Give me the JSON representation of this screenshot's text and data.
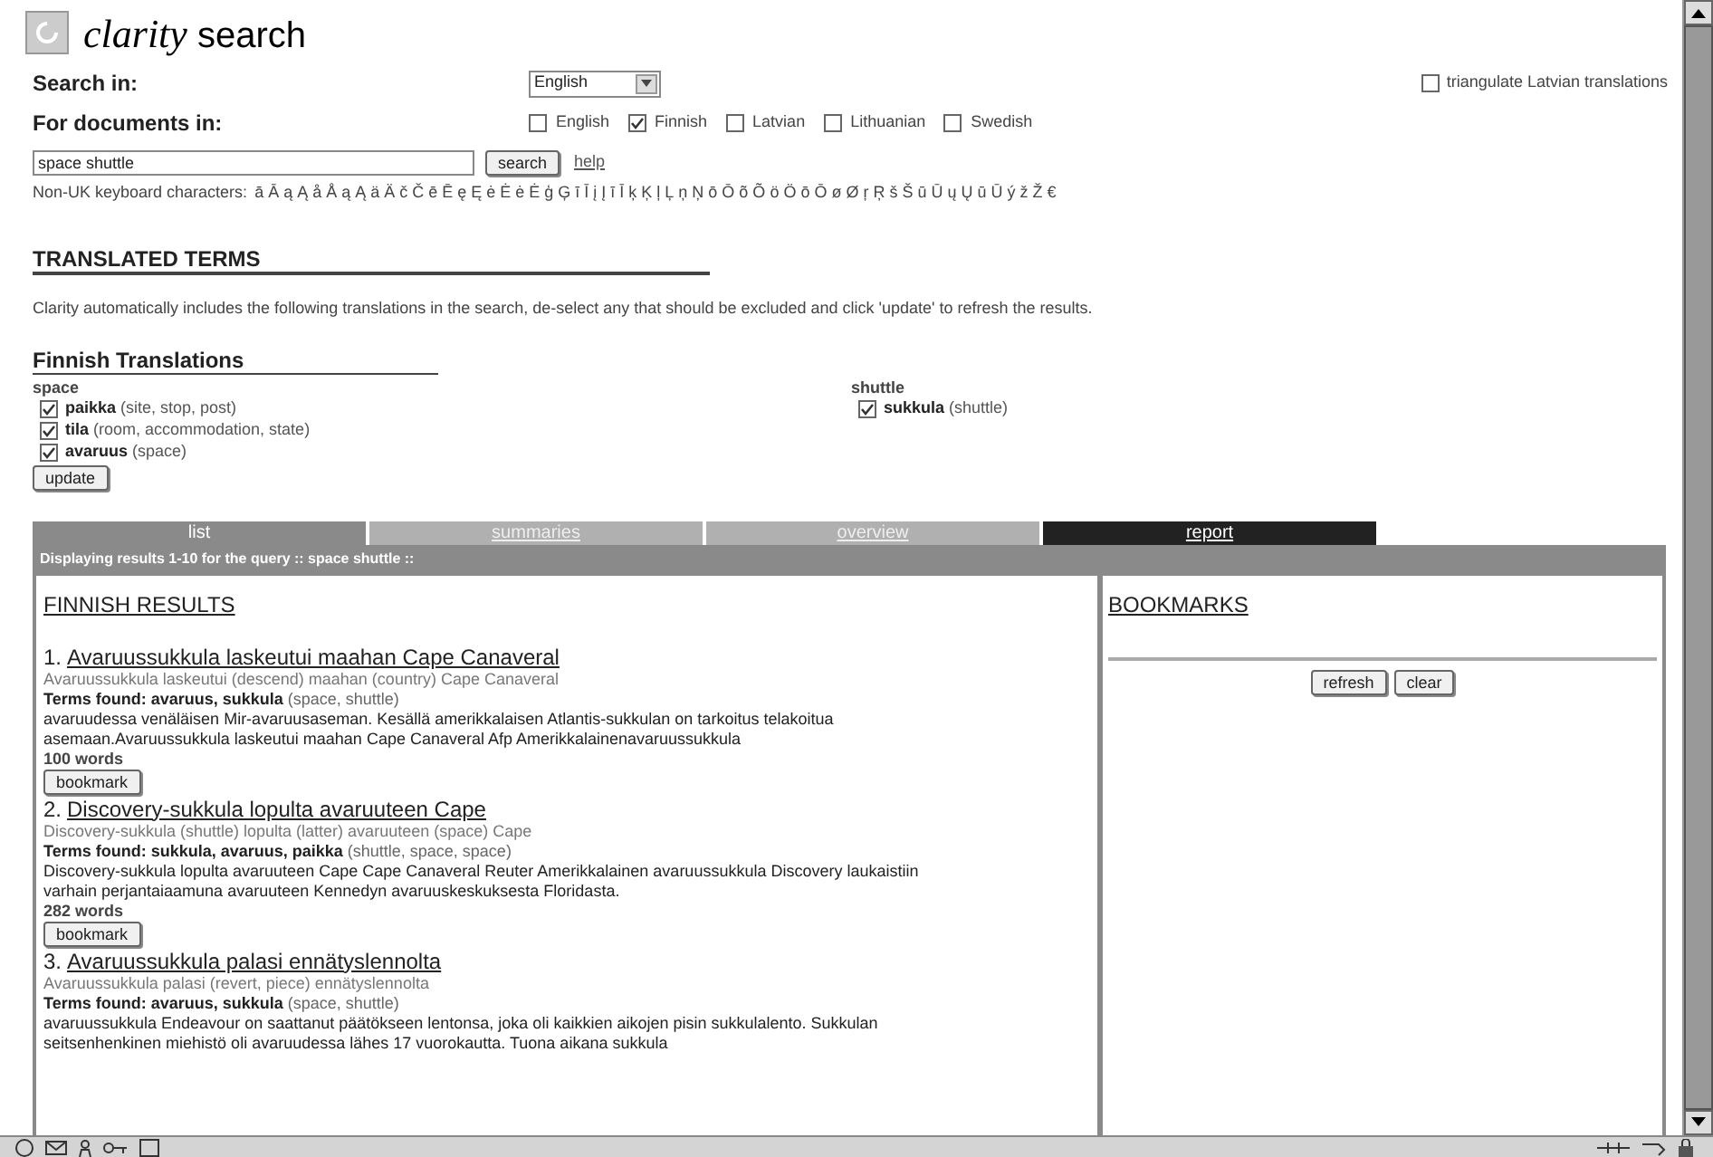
{
  "logo": {
    "italic": "clarity",
    "rest": "search"
  },
  "search_in": {
    "label": "Search in:",
    "value": "English"
  },
  "triangulate": {
    "label": "triangulate Latvian translations",
    "checked": false
  },
  "documents_in": {
    "label": "For documents in:",
    "languages": [
      {
        "label": "English",
        "checked": false
      },
      {
        "label": "Finnish",
        "checked": true
      },
      {
        "label": "Latvian",
        "checked": false
      },
      {
        "label": "Lithuanian",
        "checked": false
      },
      {
        "label": "Swedish",
        "checked": false
      }
    ]
  },
  "query": {
    "value": "space shuttle",
    "button": "search",
    "help": "help"
  },
  "keyboard": {
    "label": "Non-UK keyboard characters:",
    "chars": "ā Ā ą Ą å Å ą Ą ä Ä č Č ē Ē ę Ę ė Ė ė Ė ģ Ģ ī Ī į Į ī Ī ķ Ķ ļ Ļ ņ Ņ ō Ō õ Õ ö Ö ō Ō ø Ø ŗ Ŗ š Š ū Ū ų Ų ū Ū ý ž Ž €"
  },
  "translated_terms": {
    "heading": "TRANSLATED TERMS",
    "note": "Clarity automatically includes the following translations in the search, de-select any that should be excluded and click 'update' to refresh the results."
  },
  "translations": {
    "heading": "Finnish Translations",
    "groups": [
      {
        "term": "space",
        "items": [
          {
            "word": "paikka",
            "gloss": "(site, stop, post)",
            "checked": true
          },
          {
            "word": "tila",
            "gloss": "(room, accommodation, state)",
            "checked": true
          },
          {
            "word": "avaruus",
            "gloss": "(space)",
            "checked": true
          }
        ]
      },
      {
        "term": "shuttle",
        "items": [
          {
            "word": "sukkula",
            "gloss": "(shuttle)",
            "checked": true
          }
        ]
      }
    ],
    "button": "update"
  },
  "tabs": [
    {
      "label": "list",
      "selected": true,
      "kind": "normal"
    },
    {
      "label": "summaries",
      "selected": false,
      "kind": "normal"
    },
    {
      "label": "overview",
      "selected": false,
      "kind": "normal"
    },
    {
      "label": "report",
      "selected": false,
      "kind": "dark"
    }
  ],
  "results_bar": "Displaying results 1-10 for the query :: space shuttle ::",
  "results": {
    "heading": "FINNISH RESULTS",
    "items": [
      {
        "number": "1.",
        "title": "Avaruussukkula laskeutui maahan Cape Canaveral",
        "gloss": "Avaruussukkula laskeutui (descend) maahan (country) Cape Canaveral",
        "terms_label": "Terms found:",
        "terms": "avaruus, sukkula",
        "terms_gloss": "(space, shuttle)",
        "snippet": "avaruudessa venäläisen Mir-avaruusaseman. Kesällä amerikkalaisen Atlantis-sukkulan on tarkoitus telakoitua asemaan.Avaruussukkula laskeutui maahan Cape Canaveral Afp Amerikkalainenavaruussukkula",
        "words": "100 words",
        "button": "bookmark"
      },
      {
        "number": "2.",
        "title": "Discovery-sukkula lopulta avaruuteen Cape",
        "gloss": "Discovery-sukkula (shuttle) lopulta (latter) avaruuteen (space) Cape",
        "terms_label": "Terms found:",
        "terms": "sukkula, avaruus, paikka",
        "terms_gloss": "(shuttle, space, space)",
        "snippet": "Discovery-sukkula lopulta avaruuteen Cape Cape Canaveral Reuter Amerikkalainen avaruussukkula Discovery laukaistiin varhain perjantaiaamuna avaruuteen Kennedyn avaruuskeskuksesta Floridasta.",
        "words": "282 words",
        "button": "bookmark"
      },
      {
        "number": "3.",
        "title": "Avaruussukkula palasi ennätyslennolta",
        "gloss": "Avaruussukkula palasi (revert, piece) ennätyslennolta",
        "terms_label": "Terms found:",
        "terms": "avaruus, sukkula",
        "terms_gloss": "(space, shuttle)",
        "snippet": "avaruussukkula Endeavour on saattanut päätökseen lentonsa, joka oli kaikkien aikojen pisin sukkulalento. Sukkulan seitsenhenkinen miehistö oli avaruudessa lähes 17 vuorokautta. Tuona aikana sukkula"
      }
    ]
  },
  "bookmarks": {
    "heading": "BOOKMARKS",
    "buttons": [
      "refresh",
      "clear"
    ]
  }
}
